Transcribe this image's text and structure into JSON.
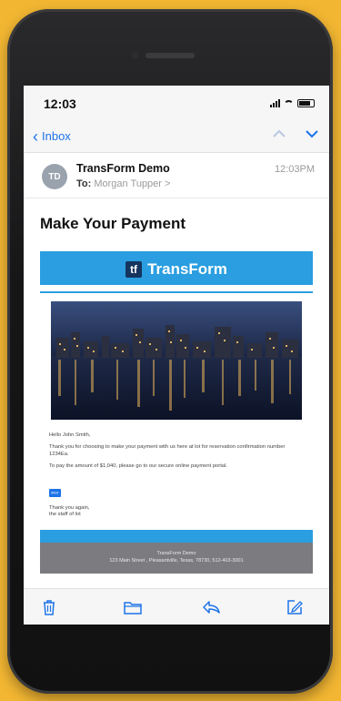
{
  "status": {
    "time": "12:03"
  },
  "nav": {
    "back_label": "Inbox"
  },
  "header": {
    "avatar_initials": "TD",
    "sender": "TransForm Demo",
    "to_label": "To:",
    "recipient": "Morgan Tupper >",
    "timestamp": "12:03PM"
  },
  "subject": "Make Your Payment",
  "email": {
    "brand_logo_mark": "tf",
    "brand_name": "TransForm",
    "greeting": "Hello John Smith,",
    "paragraph_1": "Thank you for choosing to make your payment with us here at lot for reservation confirmation number 1234Ea.",
    "paragraph_2": "To pay the amount of $1,040, please go to our secure online payment portal.",
    "pay_button": "PAY",
    "signoff_1": "Thank you again,",
    "signoff_2": "the staff of lot",
    "footer_line_1": "TransForm Demo",
    "footer_line_2": "123 Main Street , Pleasantville, Texas, 78730, 512-403-3001"
  },
  "toolbar": {
    "items": [
      "trash-icon",
      "folder-icon",
      "reply-icon",
      "compose-icon"
    ]
  },
  "colors": {
    "accent": "#1e73e8",
    "brand_blue": "#2a9ee0",
    "background": "#f2b632"
  }
}
